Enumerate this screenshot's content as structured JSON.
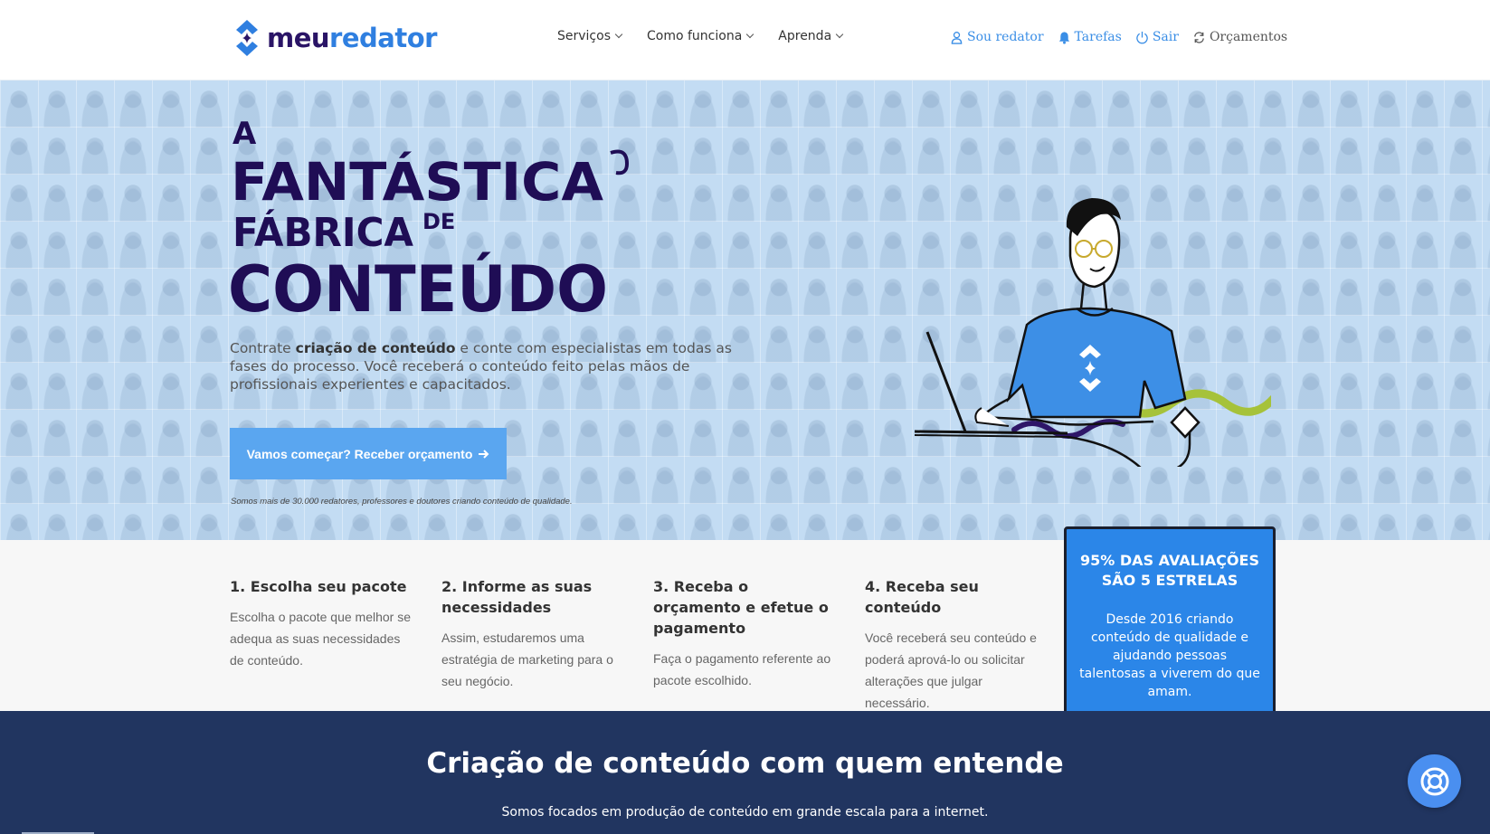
{
  "brand": {
    "prefix": "meu",
    "suffix": "redator"
  },
  "nav": {
    "items": [
      {
        "label": "Serviços"
      },
      {
        "label": "Como funciona"
      },
      {
        "label": "Aprenda"
      }
    ]
  },
  "user_nav": {
    "profile": "Sou redator",
    "tasks": "Tarefas",
    "logout": "Sair",
    "quotes": "Orçamentos"
  },
  "hero": {
    "title_line1": "A",
    "title_line2": "FANTÁSTICA",
    "title_line3a": "FÁBRICA",
    "title_line3b": "DE",
    "title_line4": "CONTEÚDO",
    "desc_prefix": "Contrate ",
    "desc_bold": "criação de conteúdo",
    "desc_suffix": " e conte com especialistas em todas as fases do processo. Você receberá o conteúdo feito pelas mãos de profissionais experientes e capacitados.",
    "cta": "Vamos começar? Receber orçamento",
    "note": "Somos mais de 30.000 redatores, professores e doutores criando conteúdo de qualidade."
  },
  "steps": [
    {
      "title": "1. Escolha seu pacote",
      "text": "Escolha o pacote que melhor se adequa as suas necessidades de conteúdo."
    },
    {
      "title": "2. Informe as suas necessidades",
      "text": "Assim, estudaremos uma estratégia de marketing para o seu negócio."
    },
    {
      "title": "3. Receba o orçamento e efetue o pagamento",
      "text": "Faça o pagamento referente ao pacote escolhido."
    },
    {
      "title": "4. Receba seu conteúdo",
      "text": "Você receberá seu conteúdo e poderá aprová-lo ou solicitar alterações que julgar necessário."
    }
  ],
  "rating": {
    "title": "95% DAS AVALIAÇÕES SÃO 5 ESTRELAS",
    "text": "Desde 2016 criando conteúdo de qualidade e ajudando pessoas talentosas a viverem do que amam."
  },
  "section": {
    "title": "Criação de conteúdo com quem entende",
    "subtitle": "Somos focados em produção de conteúdo em grande escala para a internet."
  },
  "colors": {
    "brand_dark": "#2a1466",
    "brand_blue": "#2f7fe0",
    "hero_bg": "#c3dcf3",
    "cta": "#5aa6f0",
    "rating_bg": "#2b86e8",
    "section_bg": "#213560"
  },
  "icons": {
    "profile": "user-icon",
    "tasks": "bell-icon",
    "logout": "power-icon",
    "quotes": "refresh-icon",
    "help": "lifebuoy-icon"
  }
}
